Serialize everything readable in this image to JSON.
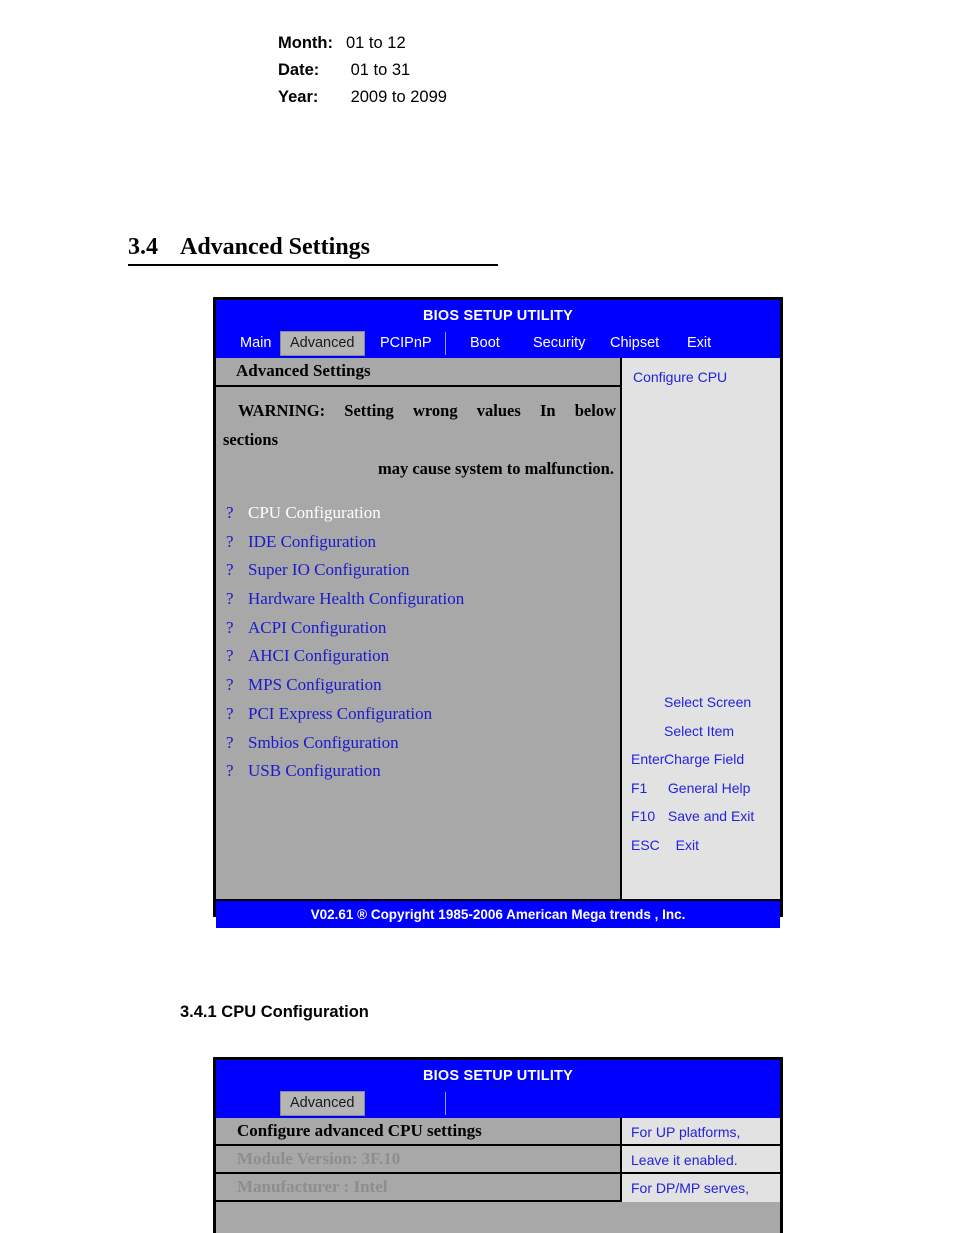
{
  "definitions": [
    {
      "term": "Month:",
      "value": "01 to 12"
    },
    {
      "term": "Date:",
      "value": " 01 to 31"
    },
    {
      "term": "Year:",
      "value": " 2009 to 2099"
    }
  ],
  "section": {
    "number": "3.4",
    "title": "Advanced Settings"
  },
  "bios_advanced": {
    "title": "BIOS SETUP UTILITY",
    "tabs": [
      {
        "label": "Main",
        "active": false
      },
      {
        "label": "Advanced",
        "active": true
      },
      {
        "label": "PCIPnP",
        "active": false
      },
      {
        "label": "Boot",
        "active": false
      },
      {
        "label": "Security",
        "active": false
      },
      {
        "label": "Chipset",
        "active": false
      },
      {
        "label": "Exit",
        "active": false
      }
    ],
    "pane_heading": "Advanced Settings",
    "warning": {
      "line1": "WARNING: Setting wrong values In below",
      "line2": "sections",
      "line3": "may cause system to malfunction."
    },
    "bullet": "?",
    "menu_items": [
      {
        "label": "CPU Configuration",
        "selected": true
      },
      {
        "label": "IDE Configuration",
        "selected": false
      },
      {
        "label": "Super IO Configuration",
        "selected": false
      },
      {
        "label": "Hardware Health Configuration",
        "selected": false
      },
      {
        "label": "ACPI Configuration",
        "selected": false
      },
      {
        "label": "AHCI Configuration",
        "selected": false
      },
      {
        "label": "MPS Configuration",
        "selected": false
      },
      {
        "label": "PCI Express Configuration",
        "selected": false
      },
      {
        "label": "Smbios Configuration",
        "selected": false
      },
      {
        "label": "USB Configuration",
        "selected": false
      }
    ],
    "help_text": "Configure CPU",
    "key_legend": [
      {
        "key": "",
        "desc": "Select Screen"
      },
      {
        "key": "",
        "desc": "Select Item"
      },
      {
        "key": "Enter",
        "desc": "Charge Field"
      },
      {
        "key": "F1",
        "desc": " General Help"
      },
      {
        "key": "F10",
        "desc": " Save and Exit"
      },
      {
        "key": "ESC",
        "desc": "   Exit"
      }
    ],
    "footer": "V02.61 ®  Copyright 1985-2006 American Mega trends , Inc."
  },
  "subsection": {
    "title": "3.4.1 CPU Configuration"
  },
  "bios_cpu": {
    "title": "BIOS SETUP UTILITY",
    "tabs": [
      {
        "label": "Advanced",
        "active": true
      }
    ],
    "rows": [
      {
        "label": "Configure advanced CPU settings",
        "style": "black"
      },
      {
        "label": "Module Version: 3F.10",
        "style": "gray"
      },
      {
        "label": "Manufacturer : Intel",
        "style": "gray"
      }
    ],
    "help_lines": [
      "For UP platforms,",
      "Leave it enabled.",
      "For DP/MP serves,"
    ]
  },
  "colors": {
    "bios_blue": "#0000ff",
    "pane_gray": "#a8a8a8",
    "help_gray": "#e2e2e2",
    "menu_blue": "#1a1acc",
    "selected_white": "#ffffff"
  }
}
